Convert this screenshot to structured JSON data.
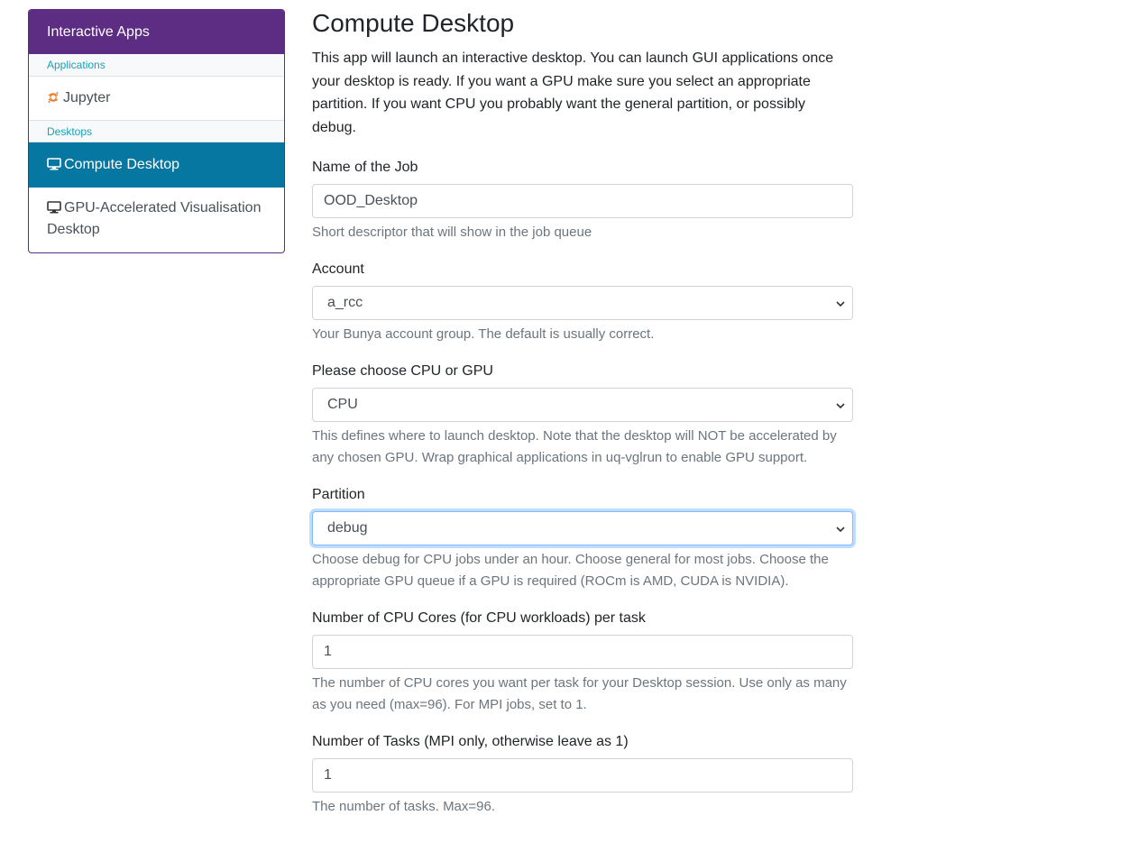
{
  "sidebar": {
    "header": "Interactive Apps",
    "sections": [
      {
        "title": "Applications",
        "items": [
          {
            "label": "Jupyter",
            "icon": "jupyter-icon"
          }
        ]
      },
      {
        "title": "Desktops",
        "items": [
          {
            "label": "Compute Desktop",
            "icon": "desktop-icon",
            "active": true
          },
          {
            "label": "GPU-Accelerated Visualisation Desktop",
            "icon": "desktop-icon"
          }
        ]
      }
    ]
  },
  "main": {
    "title": "Compute Desktop",
    "description": "This app will launch an interactive desktop. You can launch GUI applications once your desktop is ready. If you want a GPU make sure you select an appropriate partition. If you want CPU you probably want the general partition, or possibly debug.",
    "fields": {
      "job_name": {
        "label": "Name of the Job",
        "value": "OOD_Desktop",
        "help": "Short descriptor that will show in the job queue"
      },
      "account": {
        "label": "Account",
        "value": "a_rcc",
        "help": "Your Bunya account group. The default is usually correct."
      },
      "cpu_gpu": {
        "label": "Please choose CPU or GPU",
        "value": "CPU",
        "help": "This defines where to launch desktop. Note that the desktop will NOT be accelerated by any chosen GPU. Wrap graphical applications in uq-vglrun to enable GPU support."
      },
      "partition": {
        "label": "Partition",
        "value": "debug",
        "help": "Choose debug for CPU jobs under an hour. Choose general for most jobs. Choose the appropriate GPU queue if a GPU is required (ROCm is AMD, CUDA is NVIDIA)."
      },
      "cpu_cores": {
        "label": "Number of CPU Cores (for CPU workloads) per task",
        "value": "1",
        "help": "The number of CPU cores you want per task for your Desktop session. Use only as many as you need (max=96). For MPI jobs, set to 1."
      },
      "tasks": {
        "label": "Number of Tasks (MPI only, otherwise leave as 1)",
        "value": "1",
        "help": "The number of tasks. Max=96."
      }
    }
  },
  "colors": {
    "sidebar_header": "#5c2d82",
    "active_item": "#0677a0",
    "section_text": "#17a2b8",
    "help_text": "#6c757d"
  }
}
